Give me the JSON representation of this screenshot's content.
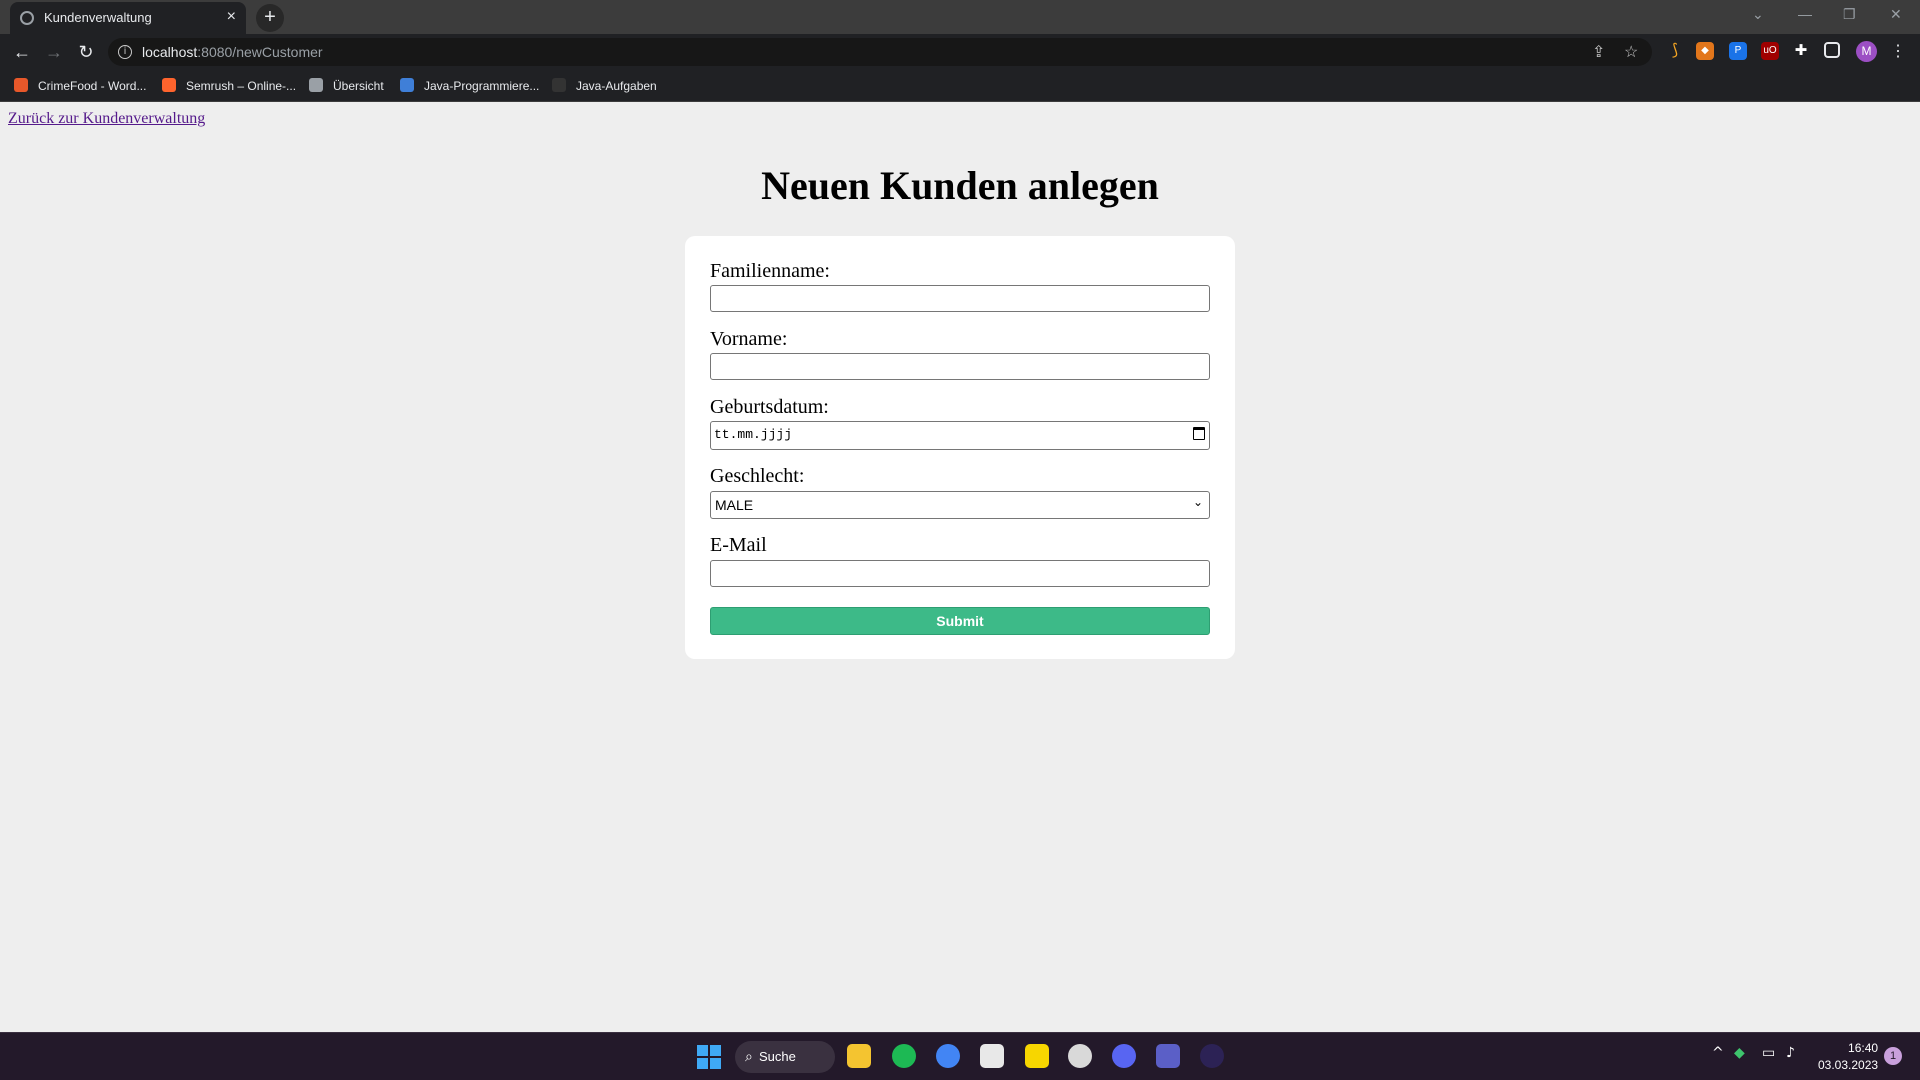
{
  "browser": {
    "tab_title": "Kundenverwaltung",
    "tab_close": "×",
    "new_tab": "+",
    "url_host": "localhost",
    "url_rest": ":8080/newCustomer",
    "avatar_letter": "M"
  },
  "bookmarks": [
    {
      "label": "CrimeFood - Word...",
      "color": "#e8582a"
    },
    {
      "label": "Semrush – Online-...",
      "color": "#ff642d"
    },
    {
      "label": "Übersicht",
      "color": "#9aa0a6"
    },
    {
      "label": "Java-Programmiere...",
      "color": "#3f7fd8"
    },
    {
      "label": "Java-Aufgaben",
      "color": "#333333"
    }
  ],
  "page": {
    "back_link": "Zurück zur Kundenverwaltung",
    "title": "Neuen Kunden anlegen"
  },
  "form": {
    "familienname_label": "Familienname:",
    "familienname_value": "",
    "vorname_label": "Vorname:",
    "vorname_value": "",
    "geburtsdatum_label": "Geburtsdatum:",
    "geburtsdatum_placeholder": "tt.mm.jjjj",
    "geschlecht_label": "Geschlecht:",
    "geschlecht_selected": "MALE",
    "email_label": "E-Mail",
    "email_value": "",
    "submit_label": "Submit"
  },
  "colors": {
    "submit_bg": "#3dba88",
    "link_color": "#551a8b",
    "page_bg": "#eeeeee"
  },
  "taskbar": {
    "search_label": "Suche",
    "time": "16:40",
    "date": "03.03.2023",
    "notification_count": "1"
  }
}
